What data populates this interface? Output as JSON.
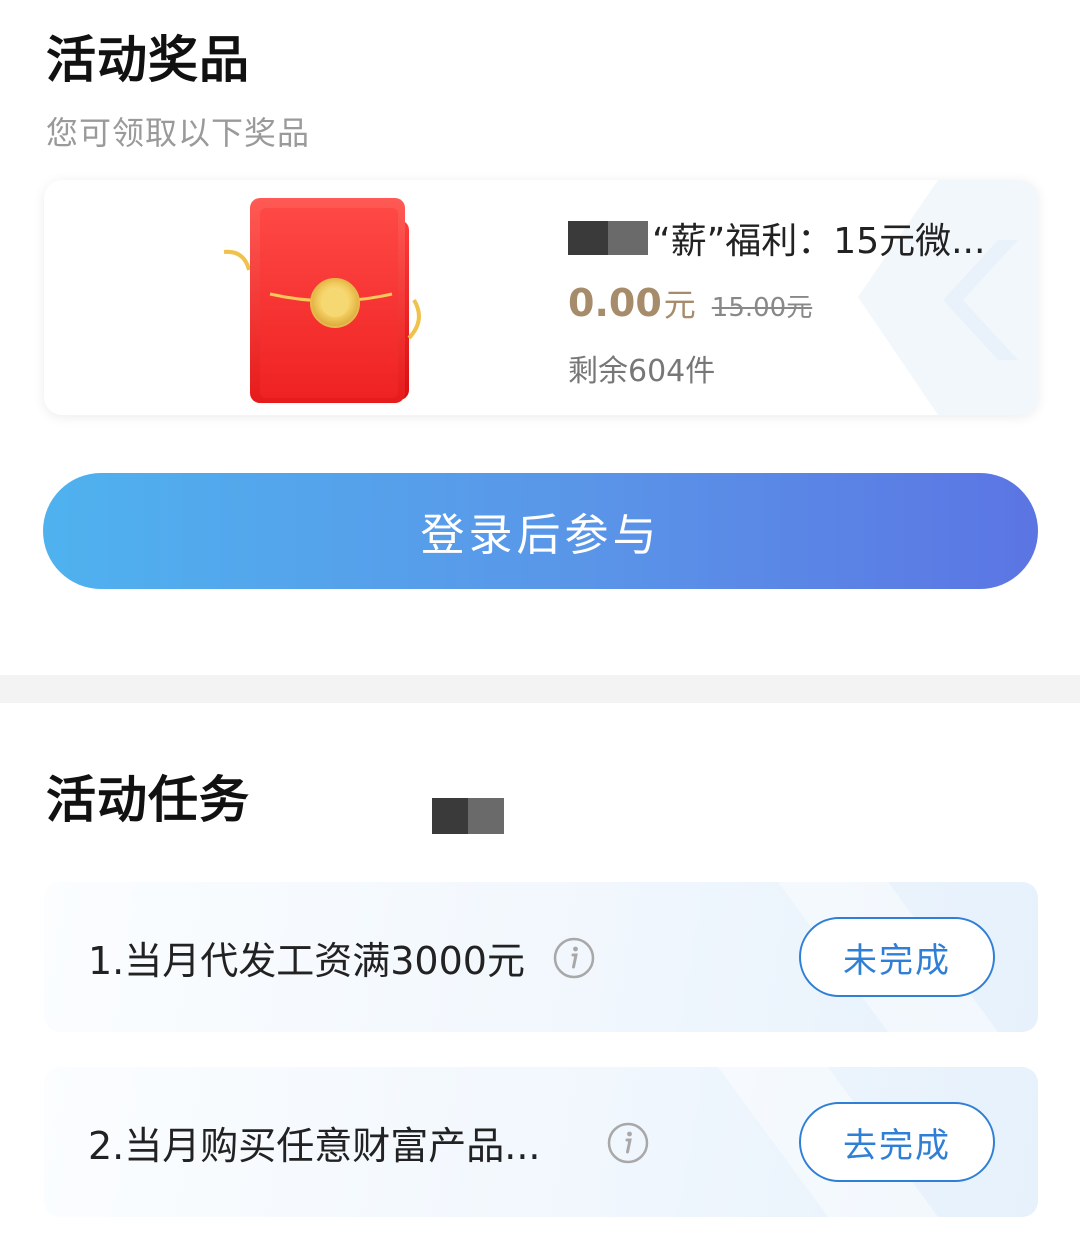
{
  "prizes_section": {
    "title": "活动奖品",
    "subtitle": "您可领取以下奖品"
  },
  "prize": {
    "name": "“薪”福利：15元微...",
    "price_current": "0.00",
    "price_unit": "元",
    "price_original": "15.00元",
    "stock": "剩余604件"
  },
  "login_button": {
    "label": "登录后参与"
  },
  "tasks_section": {
    "title": "活动任务"
  },
  "tasks": [
    {
      "text": "1.当月代发工资满3000元",
      "button": "未完成"
    },
    {
      "text": "2.当月购买任意财富产品...",
      "button": "去完成"
    }
  ],
  "colors": {
    "accent_blue": "#2f7fd6",
    "price_gold": "#a68c6b",
    "button_gradient_start": "#4fb2ef",
    "button_gradient_end": "#5b75e3"
  },
  "icons": [
    "red-envelope-icon",
    "info-icon"
  ]
}
